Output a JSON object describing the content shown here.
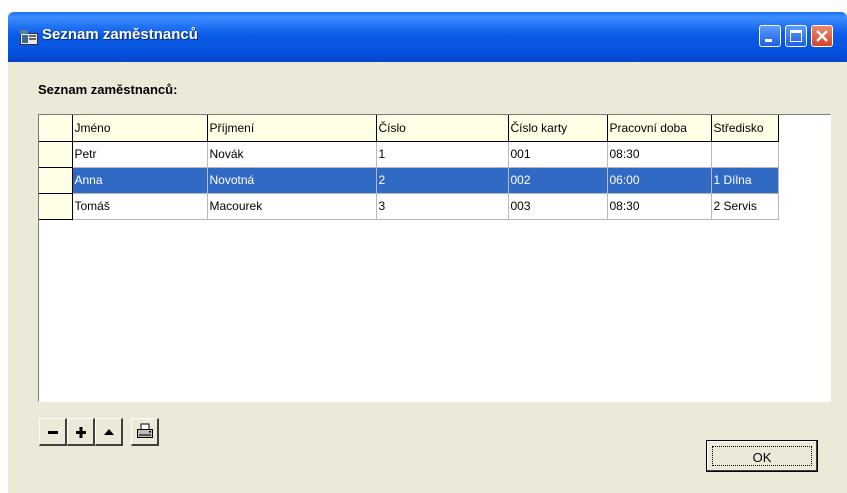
{
  "window": {
    "title": "Seznam zaměstnanců"
  },
  "section_label": "Seznam zaměstnanců:",
  "table": {
    "columns": [
      "Jméno",
      "Příjmení",
      "Číslo",
      "Číslo karty",
      "Pracovní doba",
      "Středisko"
    ],
    "rows": [
      [
        "Petr",
        "Novák",
        "1",
        "001",
        "08:30",
        ""
      ],
      [
        "Anna",
        "Novotná",
        "2",
        "002",
        "06:00",
        "1 Dílna"
      ],
      [
        "Tomáš",
        "Macourek",
        "3",
        "003",
        "08:30",
        "2 Servis"
      ]
    ],
    "selected_row": 1
  },
  "toolbar": [
    {
      "name": "delete-button",
      "icon": "minus-icon"
    },
    {
      "name": "add-button",
      "icon": "plus-icon"
    },
    {
      "name": "move-up-button",
      "icon": "triangle-up-icon"
    },
    {
      "name": "print-button",
      "icon": "printer-icon"
    }
  ],
  "ok_button": {
    "label": "OK"
  },
  "colors": {
    "selection": "#316ac5",
    "header_bg": "#ffffe6",
    "titlebar": "#0a5ce8"
  }
}
